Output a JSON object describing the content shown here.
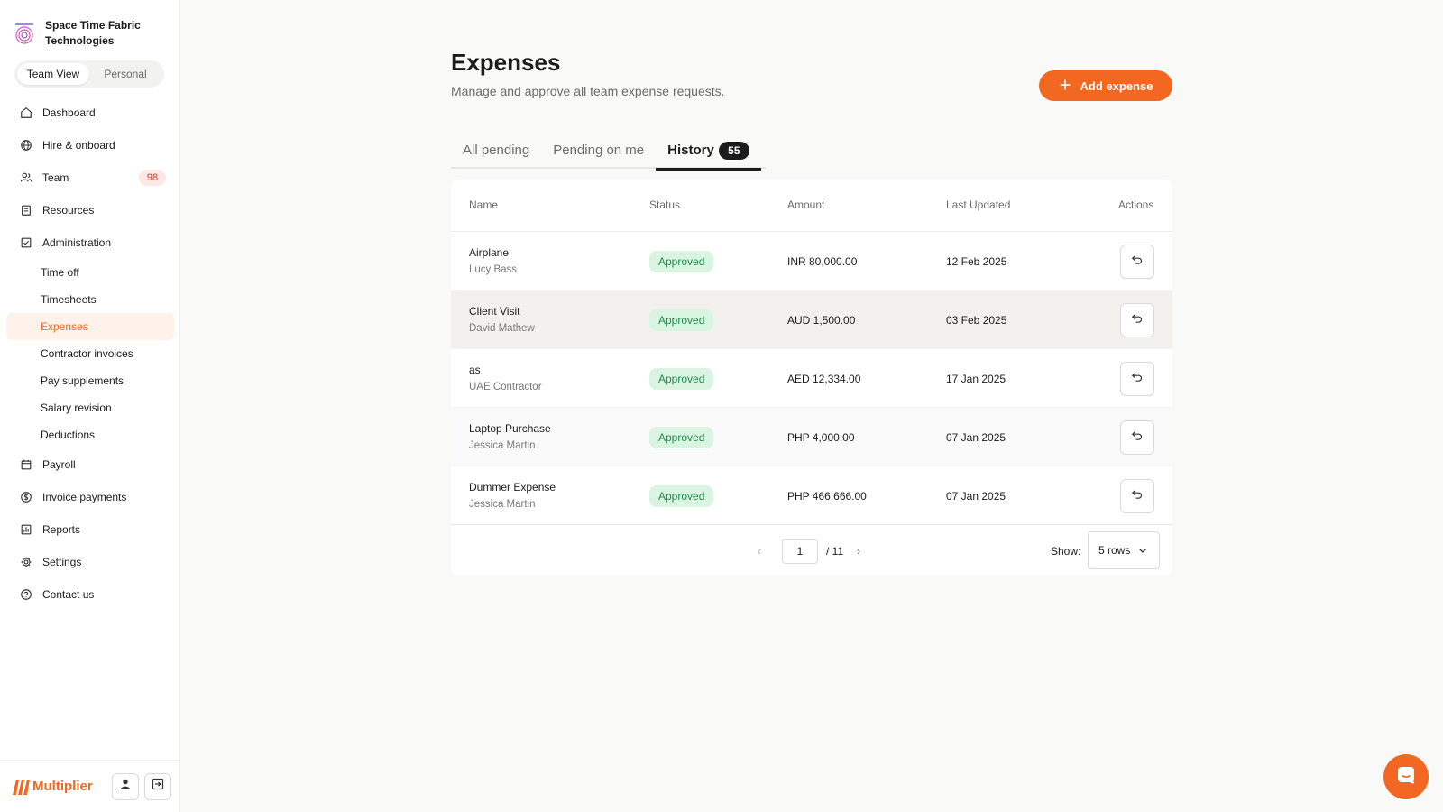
{
  "org": {
    "name": "Space Time Fabric Technologies"
  },
  "view_toggle": {
    "team": "Team View",
    "personal": "Personal"
  },
  "nav": {
    "dashboard": "Dashboard",
    "hire": "Hire & onboard",
    "team": "Team",
    "team_count": "98",
    "resources": "Resources",
    "administration": "Administration",
    "sub": {
      "time_off": "Time off",
      "timesheets": "Timesheets",
      "expenses": "Expenses",
      "contractor_invoices": "Contractor invoices",
      "pay_supplements": "Pay supplements",
      "salary_revision": "Salary revision",
      "deductions": "Deductions"
    },
    "payroll": "Payroll",
    "invoice_payments": "Invoice payments",
    "reports": "Reports",
    "settings": "Settings",
    "contact": "Contact us"
  },
  "brand": {
    "name": "Multiplier"
  },
  "header": {
    "title": "Expenses",
    "subtitle": "Manage and approve all team expense requests.",
    "add_label": "Add expense"
  },
  "tabs": {
    "all_pending": "All pending",
    "pending_on_me": "Pending on me",
    "history": "History",
    "history_count": "55"
  },
  "table": {
    "columns": {
      "name": "Name",
      "status": "Status",
      "amount": "Amount",
      "updated": "Last Updated",
      "actions": "Actions"
    },
    "rows": [
      {
        "name": "Airplane",
        "person": "Lucy Bass",
        "status": "Approved",
        "amount": "INR 80,000.00",
        "date": "12 Feb 2025"
      },
      {
        "name": "Client Visit",
        "person": "David Mathew",
        "status": "Approved",
        "amount": "AUD 1,500.00",
        "date": "03 Feb 2025"
      },
      {
        "name": "as",
        "person": "UAE Contractor",
        "status": "Approved",
        "amount": "AED 12,334.00",
        "date": "17 Jan 2025"
      },
      {
        "name": "Laptop Purchase",
        "person": "Jessica Martin",
        "status": "Approved",
        "amount": "PHP 4,000.00",
        "date": "07 Jan 2025"
      },
      {
        "name": "Dummer Expense",
        "person": "Jessica Martin",
        "status": "Approved",
        "amount": "PHP 466,666.00",
        "date": "07 Jan 2025"
      }
    ]
  },
  "pagination": {
    "current_page": "1",
    "total": "/ 11",
    "show_label": "Show:",
    "rows_value": "5 rows"
  },
  "colors": {
    "accent": "#f26722",
    "approved_bg": "#d9f5e2",
    "approved_text": "#1f8a4c",
    "badge_red": "#d13b2c"
  }
}
